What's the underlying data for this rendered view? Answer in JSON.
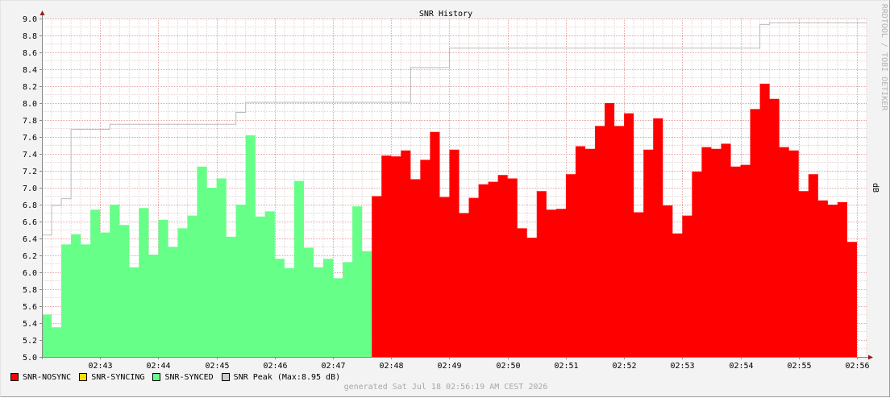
{
  "chart_data": {
    "type": "area",
    "title": "SNR History",
    "ylabel": "dB",
    "watermark": "RRDTOOL / TOBI OETIKER",
    "footer": "generated Sat Jul 18 02:56:19 AM CEST 2026",
    "ylim": [
      5.0,
      9.0
    ],
    "y_ticks": [
      "5.0",
      "5.2",
      "5.4",
      "5.6",
      "5.8",
      "6.0",
      "6.2",
      "6.4",
      "6.6",
      "6.8",
      "7.0",
      "7.2",
      "7.4",
      "7.6",
      "7.8",
      "8.0",
      "8.2",
      "8.4",
      "8.6",
      "8.8",
      "9.0"
    ],
    "x_range_minutes": [
      "02:42:00",
      "02:56:10"
    ],
    "x_ticks": [
      "02:43",
      "02:44",
      "02:45",
      "02:46",
      "02:47",
      "02:48",
      "02:49",
      "02:50",
      "02:51",
      "02:52",
      "02:53",
      "02:54",
      "02:55",
      "02:56"
    ],
    "grid": true,
    "legend": [
      {
        "name": "SNR-NOSYNC",
        "color": "#ff0000"
      },
      {
        "name": "SNR-SYNCING",
        "color": "#ffdd00"
      },
      {
        "name": "SNR-SYNCED",
        "color": "#66ff88"
      },
      {
        "name": "SNR Peak",
        "color": "#cccccc",
        "extra": "(Max:8.95 dB)"
      }
    ],
    "legend_placement": "bottom-left",
    "series": [
      {
        "name": "SNR-SYNCED",
        "color": "#66ff88",
        "start_time": "02:42:00",
        "step_seconds": 10,
        "values": [
          5.5,
          5.35,
          6.33,
          6.45,
          6.33,
          6.74,
          6.47,
          6.8,
          6.56,
          6.06,
          6.76,
          6.21,
          6.62,
          6.3,
          6.52,
          6.67,
          7.25,
          7.0,
          7.11,
          6.42,
          6.8,
          7.62,
          6.66,
          6.72,
          6.16,
          6.05,
          7.08,
          6.29,
          6.06,
          6.16,
          5.93,
          6.12,
          6.78,
          6.25
        ]
      },
      {
        "name": "SNR-NOSYNC",
        "color": "#ff0000",
        "start_time": "02:47:40",
        "step_seconds": 10,
        "values": [
          6.9,
          7.38,
          7.37,
          7.44,
          7.1,
          7.33,
          7.66,
          6.89,
          7.45,
          6.7,
          6.88,
          7.04,
          7.07,
          7.15,
          7.11,
          6.52,
          6.41,
          6.96,
          6.74,
          6.75,
          7.16,
          7.49,
          7.46,
          7.73,
          8.0,
          7.73,
          7.88,
          6.71,
          7.45,
          7.82,
          6.79,
          6.46,
          6.67,
          7.19,
          7.48,
          7.46,
          7.52,
          7.25,
          7.27,
          7.93,
          8.23,
          8.05,
          7.48,
          7.44,
          6.96,
          7.16,
          6.85,
          6.8,
          6.83,
          6.36
        ]
      },
      {
        "name": "SNR Peak",
        "color": "#cccccc",
        "type": "step-line",
        "points": [
          [
            "02:42:00",
            6.44
          ],
          [
            "02:42:10",
            6.79
          ],
          [
            "02:42:20",
            6.87
          ],
          [
            "02:42:30",
            7.69
          ],
          [
            "02:43:10",
            7.75
          ],
          [
            "02:45:20",
            7.89
          ],
          [
            "02:45:30",
            8.01
          ],
          [
            "02:48:20",
            8.42
          ],
          [
            "02:49:00",
            8.65
          ],
          [
            "02:54:20",
            8.93
          ],
          [
            "02:54:30",
            8.95
          ],
          [
            "02:56:10",
            8.95
          ]
        ]
      }
    ]
  }
}
